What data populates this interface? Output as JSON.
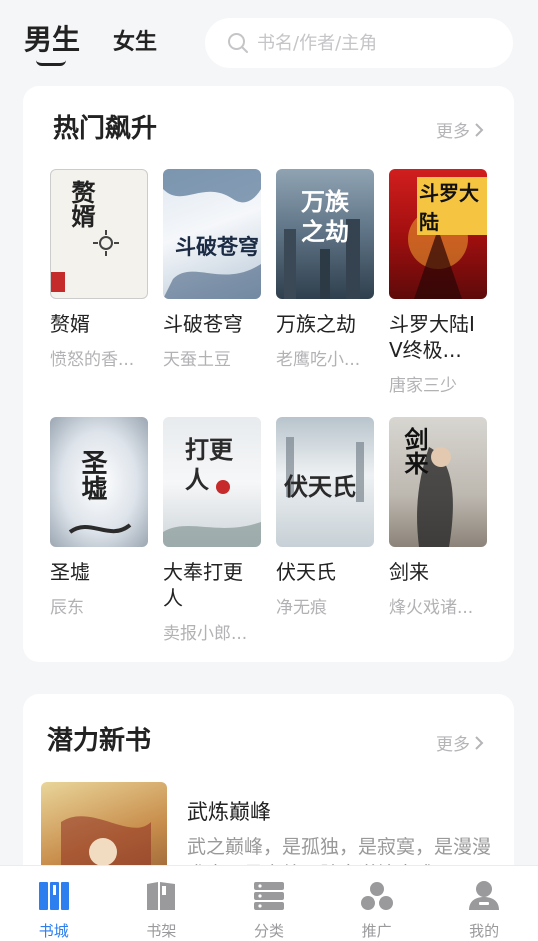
{
  "header": {
    "tabs": [
      {
        "label": "男生",
        "active": true
      },
      {
        "label": "女生",
        "active": false
      }
    ],
    "search_placeholder": "书名/作者/主角"
  },
  "hot_section": {
    "title": "热门飙升",
    "more_label": "更多",
    "books": [
      {
        "title": "赘婿",
        "author": "愤怒的香...",
        "cover_text": "赘婿"
      },
      {
        "title": "斗破苍穹",
        "author": "天蚕土豆",
        "cover_text": "斗破苍穹"
      },
      {
        "title": "万族之劫",
        "author": "老鹰吃小...",
        "cover_text": "万族之劫"
      },
      {
        "title": "斗罗大陆IV终极...",
        "author": "唐家三少",
        "cover_text": "斗罗大陆"
      },
      {
        "title": "圣墟",
        "author": "辰东",
        "cover_text": "圣墟"
      },
      {
        "title": "大奉打更人",
        "author": "卖报小郎...",
        "cover_text": "打更人"
      },
      {
        "title": "伏天氏",
        "author": "净无痕",
        "cover_text": "伏天氏"
      },
      {
        "title": "剑来",
        "author": "烽火戏诸...",
        "cover_text": "剑来"
      }
    ]
  },
  "new_section": {
    "title": "潜力新书",
    "more_label": "更多",
    "book": {
      "title": "武炼巅峰",
      "description": "武之巅峰，是孤独，是寂寞，是漫漫求索，是高处不胜寒逆境中成..."
    }
  },
  "bottom_nav": [
    {
      "label": "书城",
      "icon": "book-city-icon",
      "active": true
    },
    {
      "label": "书架",
      "icon": "bookshelf-icon",
      "active": false
    },
    {
      "label": "分类",
      "icon": "category-icon",
      "active": false
    },
    {
      "label": "推广",
      "icon": "promote-icon",
      "active": false
    },
    {
      "label": "我的",
      "icon": "profile-icon",
      "active": false
    }
  ],
  "colors": {
    "accent": "#2d7ff0",
    "inactive": "#9a9a9d"
  }
}
